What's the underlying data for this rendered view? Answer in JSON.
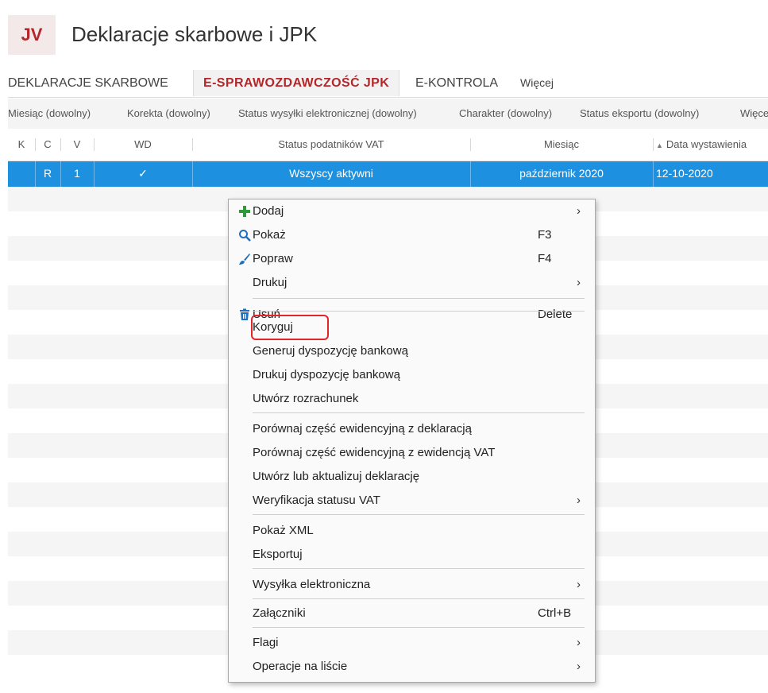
{
  "app": {
    "logo": "JV",
    "title": "Deklaracje skarbowe i JPK"
  },
  "tabs": [
    {
      "label": "DEKLARACJE SKARBOWE"
    },
    {
      "label": "E-SPRAWOZDAWCZOŚĆ JPK"
    },
    {
      "label": "E-KONTROLA"
    },
    {
      "label": "Więcej"
    }
  ],
  "filters": [
    {
      "label": "Miesiąc (dowolny)"
    },
    {
      "label": "Korekta (dowolny)"
    },
    {
      "label": "Status wysyłki elektronicznej (dowolny)"
    },
    {
      "label": "Charakter (dowolny)"
    },
    {
      "label": "Status eksportu (dowolny)"
    },
    {
      "label": "Więcej"
    }
  ],
  "columns": [
    {
      "label": "K"
    },
    {
      "label": "C"
    },
    {
      "label": "V"
    },
    {
      "label": "WD"
    },
    {
      "label": "Status podatników VAT"
    },
    {
      "label": "Miesiąc"
    },
    {
      "label": "Data wystawienia"
    }
  ],
  "selected_row": {
    "k": "",
    "c": "R",
    "v": "1",
    "wd": "✓",
    "status": "Wszyscy aktywni",
    "month": "październik 2020",
    "date": "12-10-2020"
  },
  "context_menu": {
    "items": [
      {
        "label": "Dodaj",
        "icon": "plus-icon",
        "shortcut": "",
        "submenu": "›"
      },
      {
        "label": "Pokaż",
        "icon": "search-icon",
        "shortcut": "F3",
        "submenu": ""
      },
      {
        "label": "Popraw",
        "icon": "brush-icon",
        "shortcut": "F4",
        "submenu": ""
      },
      {
        "label": "Drukuj",
        "icon": "",
        "shortcut": "",
        "submenu": "›"
      },
      {
        "label": "Usuń",
        "icon": "trash-icon",
        "shortcut": "Delete",
        "submenu": ""
      },
      {
        "label": "Koryguj",
        "icon": "",
        "shortcut": "",
        "submenu": ""
      },
      {
        "label": "Generuj dyspozycję bankową",
        "icon": "",
        "shortcut": "",
        "submenu": ""
      },
      {
        "label": "Drukuj dyspozycję bankową",
        "icon": "",
        "shortcut": "",
        "submenu": ""
      },
      {
        "label": "Utwórz rozrachunek",
        "icon": "",
        "shortcut": "",
        "submenu": ""
      },
      {
        "label": "Porównaj część ewidencyjną z deklaracją",
        "icon": "",
        "shortcut": "",
        "submenu": ""
      },
      {
        "label": "Porównaj część ewidencyjną z ewidencją VAT",
        "icon": "",
        "shortcut": "",
        "submenu": ""
      },
      {
        "label": "Utwórz lub aktualizuj deklarację",
        "icon": "",
        "shortcut": "",
        "submenu": ""
      },
      {
        "label": "Weryfikacja statusu VAT",
        "icon": "",
        "shortcut": "",
        "submenu": "›"
      },
      {
        "label": "Pokaż XML",
        "icon": "",
        "shortcut": "",
        "submenu": ""
      },
      {
        "label": "Eksportuj",
        "icon": "",
        "shortcut": "",
        "submenu": ""
      },
      {
        "label": "Wysyłka elektroniczna",
        "icon": "",
        "shortcut": "",
        "submenu": "›"
      },
      {
        "label": "Załączniki",
        "icon": "",
        "shortcut": "Ctrl+B",
        "submenu": ""
      },
      {
        "label": "Flagi",
        "icon": "",
        "shortcut": "",
        "submenu": "›"
      },
      {
        "label": "Operacje na liście",
        "icon": "",
        "shortcut": "",
        "submenu": "›"
      }
    ]
  },
  "colors": {
    "accent": "#b5262a",
    "selection": "#1e90e0",
    "highlight_border": "#e0262b"
  }
}
